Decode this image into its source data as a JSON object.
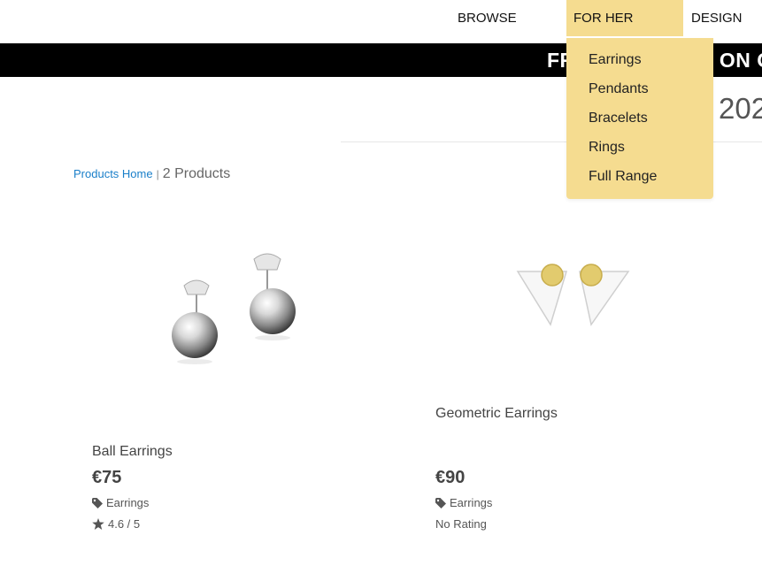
{
  "nav": {
    "browse": "BROWSE",
    "for_her": "FOR HER",
    "design": "DESIGN"
  },
  "promo": {
    "text": "FREE DELIVERY ON ORDERS"
  },
  "heading_fragment": "202",
  "dropdown": {
    "items": [
      "Earrings",
      "Pendants",
      "Bracelets",
      "Rings",
      "Full Range"
    ]
  },
  "breadcrumb": {
    "home_link": "Products Home",
    "separator": "|",
    "count": "2 Products"
  },
  "products": [
    {
      "title": "Ball Earrings",
      "price": "€75",
      "category": "Earrings",
      "rating": "4.6 / 5",
      "category_icon": "tag-icon",
      "rating_icon": "star-icon"
    },
    {
      "title": "Geometric Earrings",
      "price": "€90",
      "category": "Earrings",
      "rating": "No Rating",
      "category_icon": "tag-icon"
    }
  ],
  "colors": {
    "accent": "#f5dc90",
    "link": "#1a7fc9",
    "promo_bg": "#000000"
  }
}
